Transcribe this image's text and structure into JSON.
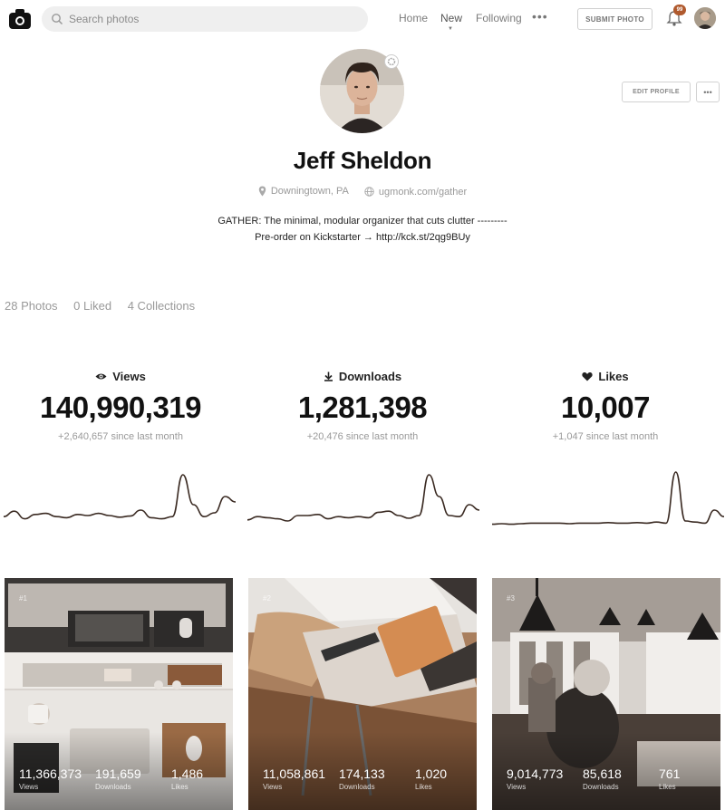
{
  "search": {
    "placeholder": "Search photos"
  },
  "nav": {
    "links": [
      "Home",
      "New",
      "Following"
    ],
    "more_label": "•••",
    "submit_label": "SUBMIT PHOTO",
    "notification_count": "99"
  },
  "profile": {
    "name": "Jeff Sheldon",
    "location": "Downingtown, PA",
    "website": "ugmonk.com/gather",
    "bio_line1": "GATHER: The minimal, modular organizer that cuts clutter  ---------",
    "bio_line2": "Pre-order on Kickstarter → http://kck.st/2qg9BUy",
    "edit_label": "EDIT PROFILE",
    "options_label": "•••"
  },
  "tabs": [
    "28 Photos",
    "0 Liked",
    "4 Collections"
  ],
  "stats": [
    {
      "label": "Views",
      "icon": "eye-icon",
      "value": "140,990,319",
      "change": "+2,640,657 since last month"
    },
    {
      "label": "Downloads",
      "icon": "download-icon",
      "value": "1,281,398",
      "change": "+20,476 since last month"
    },
    {
      "label": "Likes",
      "icon": "heart-icon",
      "value": "10,007",
      "change": "+1,047 since last month"
    }
  ],
  "sparklines": [
    [
      0.18,
      0.28,
      0.14,
      0.22,
      0.24,
      0.18,
      0.16,
      0.22,
      0.2,
      0.24,
      0.2,
      0.17,
      0.19,
      0.3,
      0.16,
      0.14,
      0.18,
      0.95,
      0.4,
      0.18,
      0.25,
      0.55,
      0.45
    ],
    [
      0.12,
      0.18,
      0.16,
      0.14,
      0.1,
      0.2,
      0.2,
      0.22,
      0.14,
      0.18,
      0.16,
      0.18,
      0.16,
      0.26,
      0.28,
      0.2,
      0.15,
      0.2,
      0.95,
      0.55,
      0.2,
      0.18,
      0.4,
      0.3
    ],
    [
      0.04,
      0.05,
      0.04,
      0.05,
      0.06,
      0.06,
      0.06,
      0.06,
      0.05,
      0.06,
      0.06,
      0.06,
      0.07,
      0.06,
      0.06,
      0.07,
      0.06,
      0.08,
      0.06,
      1.0,
      0.1,
      0.08,
      0.06,
      0.3,
      0.18
    ]
  ],
  "photos": [
    {
      "rank": "#1",
      "views": "11,366,373",
      "downloads": "191,659",
      "likes": "1,486"
    },
    {
      "rank": "#2",
      "views": "11,058,861",
      "downloads": "174,133",
      "likes": "1,020"
    },
    {
      "rank": "#3",
      "views": "9,014,773",
      "downloads": "85,618",
      "likes": "761"
    }
  ],
  "photo_captions": {
    "views": "Views",
    "downloads": "Downloads",
    "likes": "Likes"
  }
}
